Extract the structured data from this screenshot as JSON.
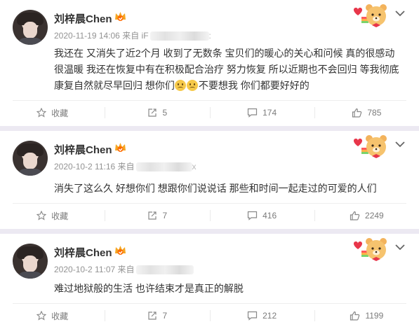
{
  "posts": [
    {
      "author": "刘梓晨Chen",
      "meta_prefix": "2020-11-19 14:06 来自 iF",
      "meta_tail": ":",
      "lines": [
        "我还在 又消失了近2个月 收到了无数条 宝贝们的暖心的关心和问候 真的很感动",
        "很温暖 我还在恢复中有在积极配合治疗 努力恢复 所以近期也不会回归 等我彻底",
        "康复自然就尽早回归 想你们",
        "不要想我 你们都要好好的"
      ],
      "actions": {
        "favorite": "收藏",
        "repost": "5",
        "comment": "174",
        "like": "785"
      }
    },
    {
      "author": "刘梓晨Chen",
      "meta_prefix": "2020-10-2 11:16 来自",
      "meta_tail": "x",
      "lines": [
        "消失了这么久 好想你们 想跟你们说说话 那些和时间一起走过的可爱的人们"
      ],
      "actions": {
        "favorite": "收藏",
        "repost": "7",
        "comment": "416",
        "like": "2249"
      }
    },
    {
      "author": "刘梓晨Chen",
      "meta_prefix": "2020-10-2 11:07 来自",
      "meta_tail": "",
      "lines": [
        "难过地狱般的生活 也许结束才是真正的解脱"
      ],
      "actions": {
        "favorite": "收藏",
        "repost": "7",
        "comment": "212",
        "like": "1199"
      }
    }
  ],
  "icons": {
    "avatar": "avatar-photo",
    "vip": "vip-crown-icon",
    "badge": "bear-badge-icon",
    "more": "chevron-down-icon",
    "favorite": "star-icon",
    "repost": "repost-icon",
    "comment": "comment-icon",
    "like": "thumbs-up-icon",
    "emoji": "sad-face-emoji"
  },
  "colors": {
    "accent": "#ff8200",
    "text": "#333333",
    "meta": "#939393",
    "background": "#ece9f2"
  }
}
